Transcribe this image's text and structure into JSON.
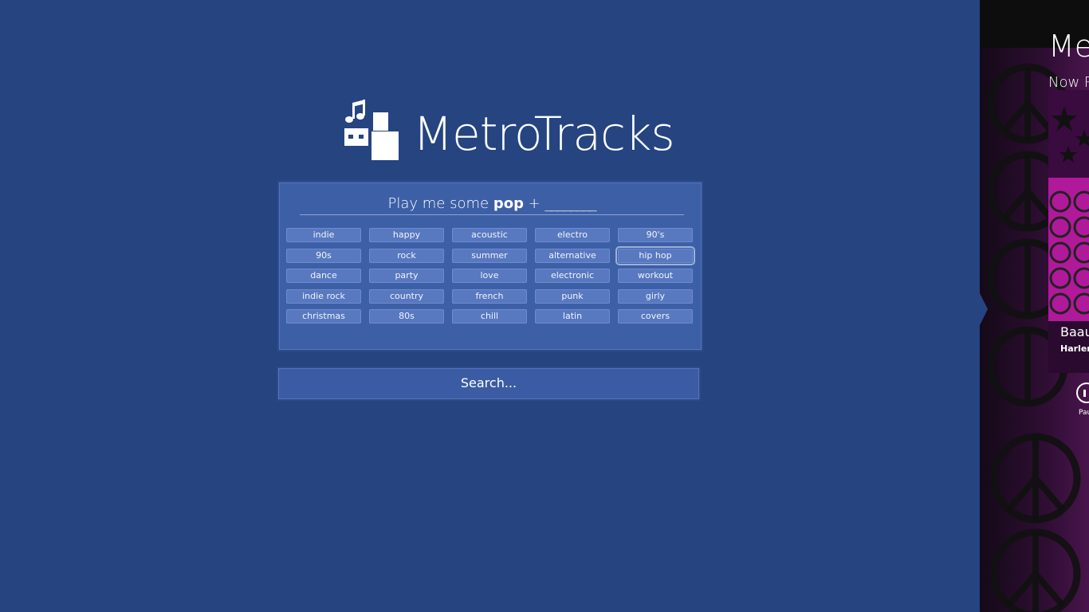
{
  "app": {
    "title": "MetroTracks"
  },
  "prompt": {
    "prefix": "Play me some ",
    "genre": "pop",
    "suffix": " + ",
    "blank": "________"
  },
  "tags": [
    "indie",
    "happy",
    "acoustic",
    "electro",
    "90's",
    "90s",
    "rock",
    "summer",
    "alternative",
    "hip hop",
    "dance",
    "party",
    "love",
    "electronic",
    "workout",
    "indie rock",
    "country",
    "french",
    "punk",
    "girly",
    "christmas",
    "80s",
    "chill",
    "latin",
    "covers"
  ],
  "selected_tag": "hip hop",
  "search": {
    "label": "Search..."
  },
  "now_playing": {
    "app_name": "Me",
    "header": "Now P",
    "track_title": "Baau",
    "artist": "Harlem",
    "pause_label": "Pau"
  },
  "colors": {
    "background": "#254480",
    "panel": "#3d5fa6",
    "tag": "#5878c0",
    "album_magenta": "#c01aa8"
  },
  "icons": {
    "logo": "music-notes-blocks-icon",
    "pause": "pause-icon"
  }
}
